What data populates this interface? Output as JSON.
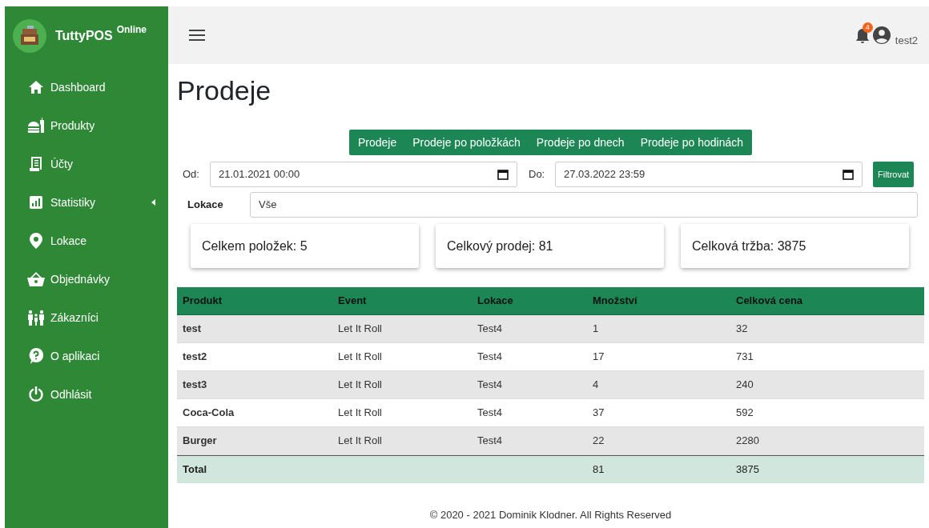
{
  "sidebar": {
    "brand": "TuttyPOS",
    "brand_sup": "Online",
    "items": [
      {
        "label": "Dashboard",
        "kind": "home",
        "submenu": false
      },
      {
        "label": "Produkty",
        "kind": "food",
        "submenu": false
      },
      {
        "label": "Účty",
        "kind": "receipt",
        "submenu": false
      },
      {
        "label": "Statistiky",
        "kind": "chart",
        "submenu": true
      },
      {
        "label": "Lokace",
        "kind": "pin",
        "submenu": false
      },
      {
        "label": "Objednávky",
        "kind": "basket",
        "submenu": false
      },
      {
        "label": "Zákazníci",
        "kind": "people",
        "submenu": false
      },
      {
        "label": "O aplikaci",
        "kind": "question",
        "submenu": false
      },
      {
        "label": "Odhlásit",
        "kind": "power",
        "submenu": false
      }
    ]
  },
  "header": {
    "notification_count": "4",
    "user": "test2"
  },
  "page_title": "Prodeje",
  "tabs": [
    "Prodeje",
    "Prodeje po položkách",
    "Prodeje po dnech",
    "Prodeje po hodinách"
  ],
  "filter": {
    "from_label": "Od:",
    "from_value": "21.01.2021 00:00",
    "to_label": "Do:",
    "to_value": "27.03.2022 23:59",
    "button": "Filtrovat",
    "location_label": "Lokace",
    "location_value": "Vše"
  },
  "cards": [
    "Celkem položek: 5",
    "Celkový prodej: 81",
    "Celková tržba: 3875"
  ],
  "table": {
    "columns": [
      "Produkt",
      "Event",
      "Lokace",
      "Množství",
      "Celková cena"
    ],
    "rows": [
      [
        "test",
        "Let It Roll",
        "Test4",
        "1",
        "32"
      ],
      [
        "test2",
        "Let It Roll",
        "Test4",
        "17",
        "731"
      ],
      [
        "test3",
        "Let It Roll",
        "Test4",
        "4",
        "240"
      ],
      [
        "Coca-Cola",
        "Let It Roll",
        "Test4",
        "37",
        "592"
      ],
      [
        "Burger",
        "Let It Roll",
        "Test4",
        "22",
        "2280"
      ]
    ],
    "total": {
      "label": "Total",
      "quantity": "81",
      "price": "3875"
    }
  },
  "footer": "© 2020 - 2021 Dominik Klodner. All Rights Reserved"
}
